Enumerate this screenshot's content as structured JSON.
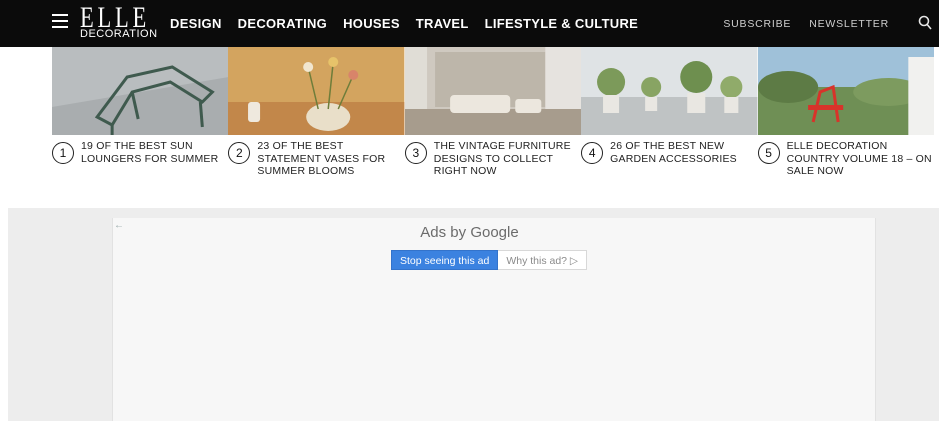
{
  "header": {
    "logo_main": "ELLE",
    "logo_sub": "DECORATION",
    "nav": [
      "DESIGN",
      "DECORATING",
      "HOUSES",
      "TRAVEL",
      "LIFESTYLE & CULTURE"
    ],
    "subscribe": "SUBSCRIBE",
    "newsletter": "NEWSLETTER"
  },
  "articles": [
    {
      "num": "1",
      "title": "19 OF THE BEST SUN LOUNGERS FOR SUMMER"
    },
    {
      "num": "2",
      "title": "23 OF THE BEST STATEMENT VASES FOR SUMMER BLOOMS"
    },
    {
      "num": "3",
      "title": "THE VINTAGE FURNITURE DESIGNS TO COLLECT RIGHT NOW"
    },
    {
      "num": "4",
      "title": "26 OF THE BEST NEW GARDEN ACCESSORIES"
    },
    {
      "num": "5",
      "title": "ELLE DECORATION COUNTRY VOLUME 18 – ON SALE NOW"
    }
  ],
  "ad": {
    "back_glyph": "←",
    "ads_by": "Ads by Google",
    "stop_label": "Stop seeing this ad",
    "why_label": "Why this ad? ▷"
  }
}
